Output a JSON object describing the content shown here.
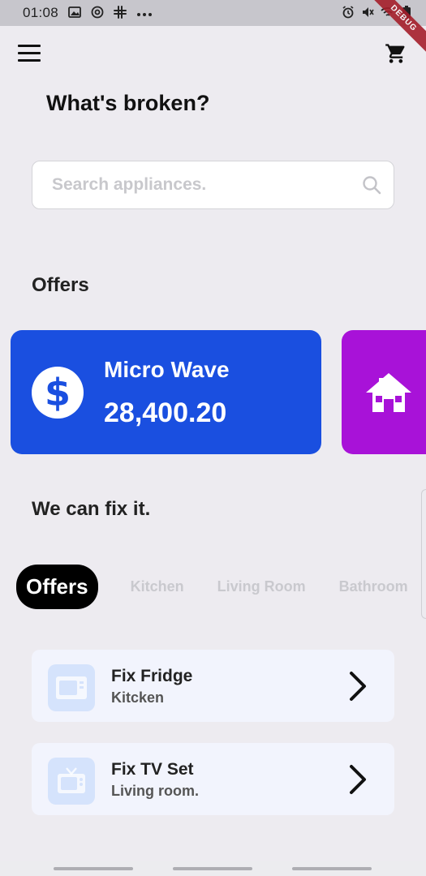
{
  "status_bar": {
    "time": "01:08",
    "left_icons": [
      "image-icon",
      "at-icon",
      "slack-icon",
      "more-icon"
    ],
    "right_icons": [
      "alarm-icon",
      "mute-icon",
      "wifi-icon",
      "battery-icon"
    ],
    "debug_label": "DEBUG"
  },
  "header": {
    "menu_icon": "menu-icon",
    "cart_icon": "cart-icon",
    "title": "What's broken?"
  },
  "search": {
    "placeholder": "Search appliances.",
    "icon": "search-icon"
  },
  "offers": {
    "heading": "Offers",
    "cards": [
      {
        "name": "Micro Wave",
        "price": "28,400.20",
        "icon": "dollar-icon",
        "color": "#1a4fe0"
      },
      {
        "icon": "home-icon",
        "color": "#a812d8"
      }
    ]
  },
  "fix": {
    "heading": "We can fix it."
  },
  "tabs": [
    {
      "label": "Offers",
      "active": true
    },
    {
      "label": "Kitchen",
      "active": false
    },
    {
      "label": "Living Room",
      "active": false
    },
    {
      "label": "Bathroom",
      "active": false
    }
  ],
  "services": [
    {
      "title": "Fix Fridge",
      "subtitle": "Kitcken",
      "icon": "microwave-icon"
    },
    {
      "title": "Fix TV Set",
      "subtitle": "Living room.",
      "icon": "tv-icon"
    }
  ],
  "colors": {
    "background": "#edebf0",
    "accent_blue": "#1a4fe0",
    "accent_purple": "#a812d8",
    "service_card": "#f2f4fd",
    "service_icon_bg": "#d5e3fc"
  }
}
